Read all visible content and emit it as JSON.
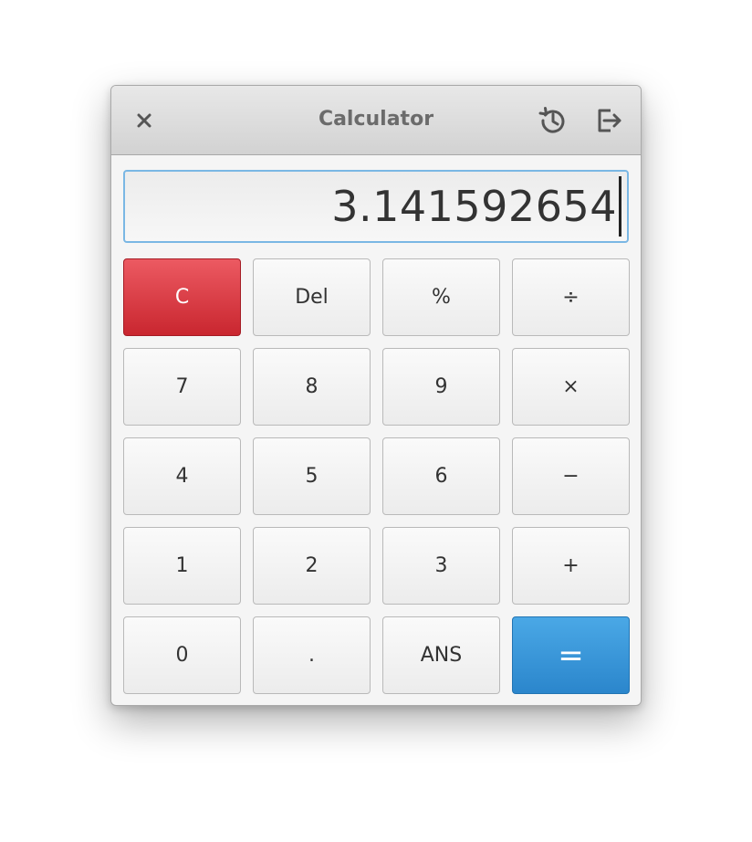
{
  "window": {
    "title": "Calculator"
  },
  "titlebar_icons": {
    "close": "close-icon",
    "history": "history-icon",
    "extend": "extend-icon"
  },
  "display": {
    "value": "3.141592654"
  },
  "keys": {
    "clear": "C",
    "del": "Del",
    "percent": "%",
    "divide": "÷",
    "seven": "7",
    "eight": "8",
    "nine": "9",
    "multiply": "×",
    "four": "4",
    "five": "5",
    "six": "6",
    "minus": "−",
    "one": "1",
    "two": "2",
    "three": "3",
    "plus": "+",
    "zero": "0",
    "point": ".",
    "ans": "ANS",
    "equals": "="
  },
  "colors": {
    "clear_button": "#d8343c",
    "equals_button": "#3a98da",
    "display_focus": "#7ab7e4"
  }
}
